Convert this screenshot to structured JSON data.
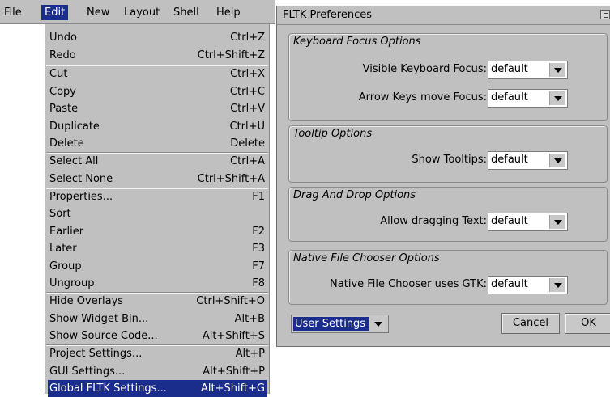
{
  "menubar": {
    "items": [
      "File",
      "Edit",
      "New",
      "Layout",
      "Shell",
      "Help"
    ]
  },
  "edit_menu": {
    "items": [
      {
        "label": "Undo",
        "shortcut": "Ctrl+Z"
      },
      {
        "label": "Redo",
        "shortcut": "Ctrl+Shift+Z"
      },
      {
        "label": "Cut",
        "shortcut": "Ctrl+X"
      },
      {
        "label": "Copy",
        "shortcut": "Ctrl+C"
      },
      {
        "label": "Paste",
        "shortcut": "Ctrl+V"
      },
      {
        "label": "Duplicate",
        "shortcut": "Ctrl+U"
      },
      {
        "label": "Delete",
        "shortcut": "Delete"
      },
      {
        "label": "Select All",
        "shortcut": "Ctrl+A"
      },
      {
        "label": "Select None",
        "shortcut": "Ctrl+Shift+A"
      },
      {
        "label": "Properties...",
        "shortcut": "F1"
      },
      {
        "label": "Sort",
        "shortcut": ""
      },
      {
        "label": "Earlier",
        "shortcut": "F2"
      },
      {
        "label": "Later",
        "shortcut": "F3"
      },
      {
        "label": "Group",
        "shortcut": "F7"
      },
      {
        "label": "Ungroup",
        "shortcut": "F8"
      },
      {
        "label": "Hide Overlays",
        "shortcut": "Ctrl+Shift+O"
      },
      {
        "label": "Show Widget Bin...",
        "shortcut": "Alt+B"
      },
      {
        "label": "Show Source Code...",
        "shortcut": "Alt+Shift+S"
      },
      {
        "label": "Project Settings...",
        "shortcut": "Alt+P"
      },
      {
        "label": "GUI Settings...",
        "shortcut": "Alt+Shift+P"
      },
      {
        "label": "Global FLTK Settings...",
        "shortcut": "Alt+Shift+G"
      }
    ]
  },
  "prefs": {
    "title": "FLTK Preferences",
    "keyboard": {
      "title": "Keyboard Focus Options",
      "visible_label": "Visible Keyboard Focus:",
      "visible_value": "default",
      "arrow_label": "Arrow Keys move Focus:",
      "arrow_value": "default"
    },
    "tooltip": {
      "title": "Tooltip Options",
      "label": "Show Tooltips:",
      "value": "default"
    },
    "dnd": {
      "title": "Drag And Drop Options",
      "label": "Allow dragging Text:",
      "value": "default"
    },
    "filechooser": {
      "title": "Native File Chooser Options",
      "label": "Native File Chooser uses GTK:",
      "value": "default"
    },
    "scope_value": "User Settings",
    "cancel_label": "Cancel",
    "ok_label": "OK"
  },
  "colors": {
    "menu_bg": "#c0c0c0",
    "highlight": "#1a2d8c"
  }
}
